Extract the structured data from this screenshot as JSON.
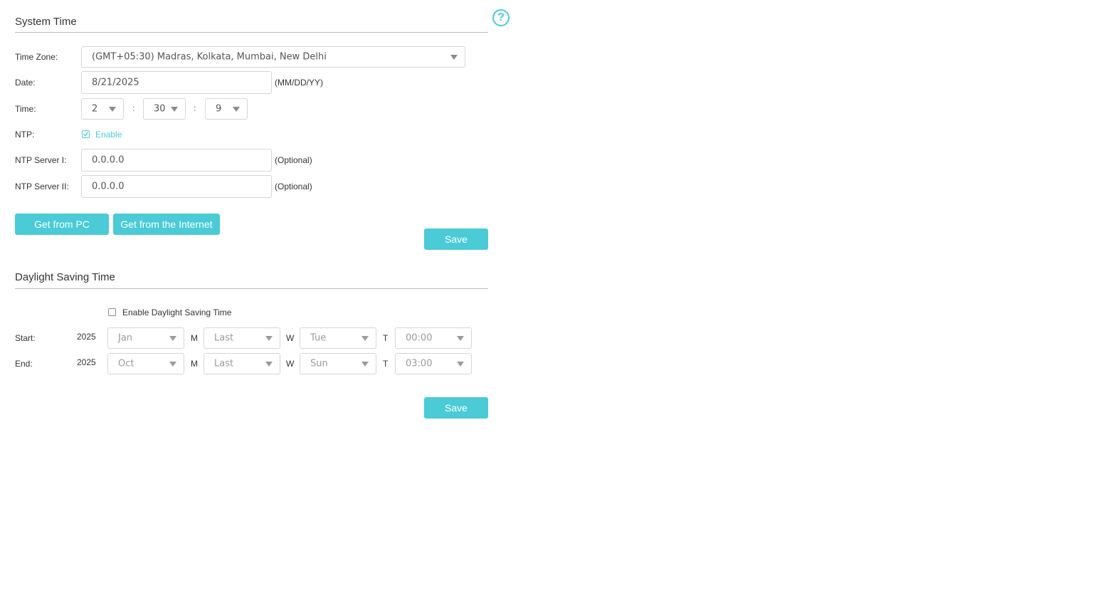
{
  "system_time": {
    "title": "System Time",
    "time_zone_label": "Time Zone:",
    "time_zone_value": "(GMT+05:30) Madras, Kolkata, Mumbai, New Delhi",
    "date_label": "Date:",
    "date_value": "8/21/2025",
    "date_hint": "(MM/DD/YY)",
    "time_label": "Time:",
    "hour": "2",
    "minute": "30",
    "second": "9",
    "colon": ":",
    "ntp_label": "NTP:",
    "ntp_enable_label": "Enable",
    "ntp_enabled": true,
    "ntp1_label": "NTP Server I:",
    "ntp1_value": "0.0.0.0",
    "ntp2_label": "NTP Server II:",
    "ntp2_value": "0.0.0.0",
    "optional_hint": "(Optional)",
    "get_from_pc": "Get from PC",
    "get_from_internet": "Get from the Internet",
    "save": "Save"
  },
  "dst": {
    "title": "Daylight Saving Time",
    "enable_label": "Enable Daylight Saving Time",
    "enabled": false,
    "start_label": "Start:",
    "end_label": "End:",
    "m_label": "M",
    "w_label": "W",
    "t_label": "T",
    "start": {
      "year": "2025",
      "month": "Jan",
      "week": "Last",
      "day": "Tue",
      "time": "00:00"
    },
    "end": {
      "year": "2025",
      "month": "Oct",
      "week": "Last",
      "day": "Sun",
      "time": "03:00"
    },
    "save": "Save"
  },
  "icons": {
    "help": "question-circle-icon",
    "checkmark": "check-icon",
    "dropdown": "chevron-down-icon"
  },
  "help_glyph": "?",
  "colors": {
    "accent": "#4acbd6",
    "text": "#333333",
    "border": "#d6d6d6"
  }
}
